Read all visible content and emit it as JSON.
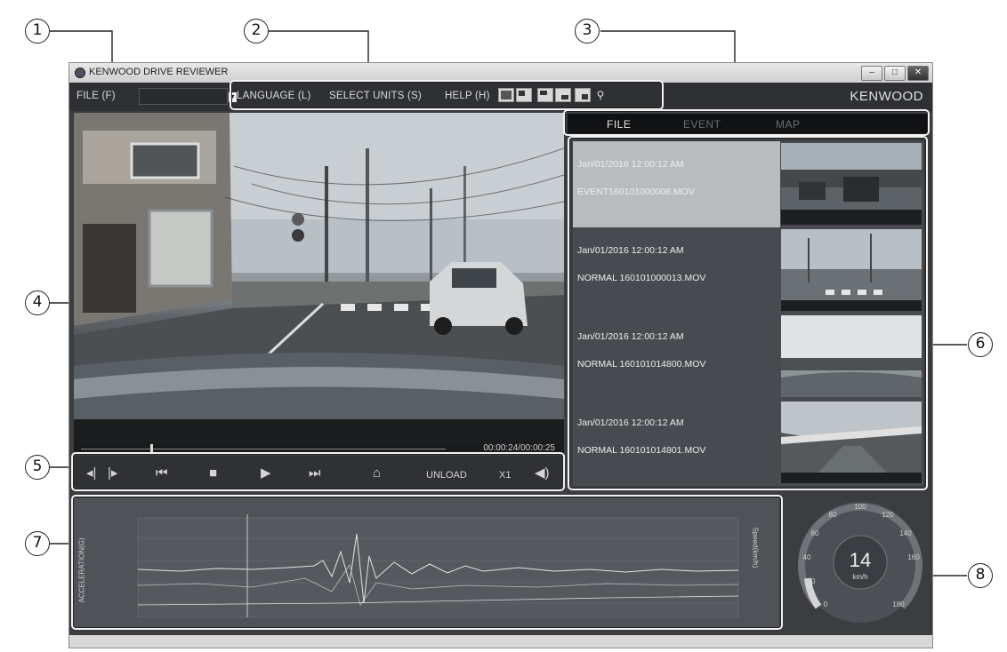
{
  "callouts": [
    "1",
    "2",
    "3",
    "4",
    "5",
    "6",
    "7",
    "8"
  ],
  "window": {
    "title": "KENWOOD DRIVE REVIEWER",
    "brand": "KENWOOD",
    "menu": {
      "file": "FILE (F)",
      "language": "LANGUAGE (L)",
      "select_units": "SELECT UNITS (S)",
      "help": "HELP (H)"
    }
  },
  "tabs": {
    "file": "FILE",
    "event": "EVENT",
    "map": "MAP"
  },
  "files": [
    {
      "datetime": "Jan/01/2016 12:00:12 AM",
      "filename": "EVENT160101000006.MOV",
      "selected": true
    },
    {
      "datetime": "Jan/01/2016 12:00:12 AM",
      "filename": "NORMAL 160101000013.MOV",
      "selected": false
    },
    {
      "datetime": "Jan/01/2016 12:00:12 AM",
      "filename": "NORMAL 160101014800.MOV",
      "selected": false
    },
    {
      "datetime": "Jan/01/2016 12:00:12 AM",
      "filename": "NORMAL 160101014801.MOV",
      "selected": false
    }
  ],
  "timeline": {
    "time": "00:00:24/00:00:25"
  },
  "controls": {
    "unload": "UNLOAD",
    "speed": "X1"
  },
  "graph": {
    "ylabel_left": "ACCELERATION(G)",
    "ylabel_right": "Speed(km/h)"
  },
  "speedometer": {
    "value": "14",
    "unit": "km/h",
    "ticks": [
      "0",
      "20",
      "40",
      "60",
      "80",
      "100",
      "120",
      "140",
      "160",
      "180"
    ]
  },
  "colors": {
    "window_bg": "#3b3d41",
    "selected_row": "#b9bcbf",
    "active_tab": "#e8e8e8",
    "inactive_tab": "#6b6d70"
  }
}
